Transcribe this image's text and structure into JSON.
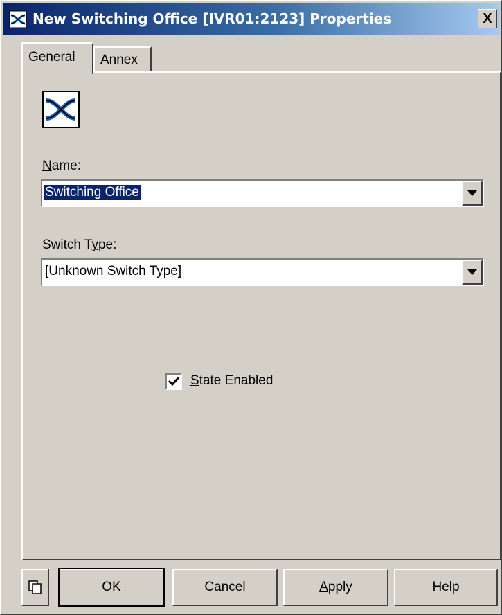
{
  "window": {
    "title": "New Switching Office [IVR01:2123] Properties",
    "close_label": "X",
    "title_icon": "switching-office-icon"
  },
  "tabs": [
    {
      "label": "General",
      "active": true
    },
    {
      "label": "Annex",
      "active": false
    }
  ],
  "general": {
    "object_icon": "switching-office-icon",
    "name_label_prefix": "N",
    "name_label_rest": "ame:",
    "name_value": "Switching Office",
    "switch_type_label_prefix": "Switch T",
    "switch_type_label_mnemonic": "y",
    "switch_type_label_rest": "pe:",
    "switch_type_value": "[Unknown Switch Type]",
    "state_enabled_mnemonic": "S",
    "state_enabled_rest": "tate Enabled",
    "state_enabled_checked": true
  },
  "buttons": {
    "copy_icon": "copy-icon",
    "ok": "OK",
    "cancel": "Cancel",
    "apply_mnemonic": "A",
    "apply_rest": "pply",
    "help": "Help"
  },
  "colors": {
    "title_start": "#0a246a",
    "title_end": "#a6caf0",
    "face": "#d4d0c8",
    "selection": "#0a246a"
  }
}
